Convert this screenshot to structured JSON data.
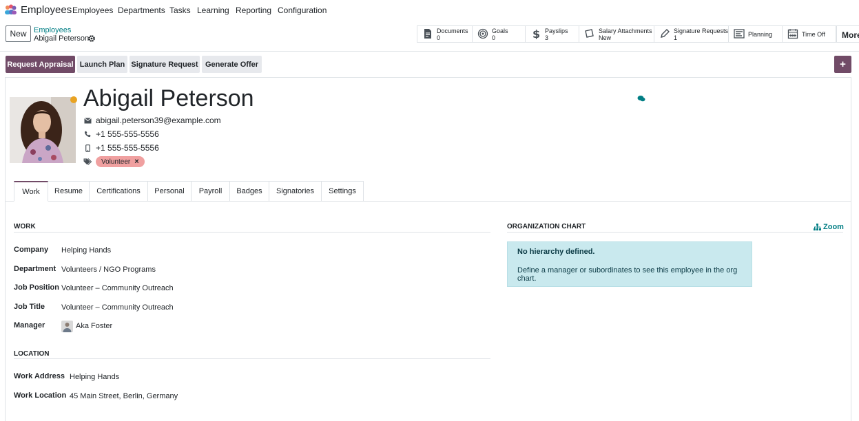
{
  "topnav": {
    "app_name": "Employees",
    "menu": [
      "Employees",
      "Departments",
      "Tasks",
      "Learning",
      "Reporting",
      "Configuration"
    ]
  },
  "control_panel": {
    "new_label": "New",
    "breadcrumb_parent": "Employees",
    "breadcrumb_current": "Abigail Peterson",
    "smart_buttons": [
      {
        "label": "Documents",
        "value": "0",
        "icon": "document-icon"
      },
      {
        "label": "Goals",
        "value": "0",
        "icon": "target-icon"
      },
      {
        "label": "Payslips",
        "value": "3",
        "icon": "dollar-icon"
      },
      {
        "label": "Salary Attachments",
        "value": "New",
        "icon": "money-icon"
      },
      {
        "label": "Signature Requests",
        "value": "1",
        "icon": "pen-icon"
      },
      {
        "label": "Planning",
        "value": "",
        "icon": "planning-icon"
      },
      {
        "label": "Time Off",
        "value": "",
        "icon": "calendar-icon"
      }
    ],
    "more_label": "More"
  },
  "actions": {
    "request_appraisal": "Request Appraisal",
    "launch_plan": "Launch Plan",
    "signature_request": "Signature Request",
    "generate_offer": "Generate Offer"
  },
  "employee": {
    "name": "Abigail Peterson",
    "email": "abigail.peterson39@example.com",
    "work_phone": "+1 555-555-5556",
    "mobile_phone": "+1 555-555-5556",
    "tag": "Volunteer",
    "status_color": "#e9a322"
  },
  "tabs": [
    "Work",
    "Resume",
    "Certifications",
    "Personal",
    "Payroll",
    "Badges",
    "Signatories",
    "Settings"
  ],
  "work_section": {
    "title": "WORK",
    "fields": [
      {
        "label": "Company",
        "value": "Helping Hands"
      },
      {
        "label": "Department",
        "value": "Volunteers / NGO Programs"
      },
      {
        "label": "Job Position",
        "value": "Volunteer – Community Outreach"
      },
      {
        "label": "Job Title",
        "value": "Volunteer – Community Outreach"
      },
      {
        "label": "Manager",
        "value": "Aka Foster"
      }
    ]
  },
  "location_section": {
    "title": "LOCATION",
    "fields": [
      {
        "label": "Work Address",
        "value": "Helping Hands"
      },
      {
        "label": "Work Location",
        "value": "45 Main Street, Berlin, Germany"
      }
    ]
  },
  "org_chart": {
    "title": "ORGANIZATION CHART",
    "zoom_label": "Zoom",
    "alert_title": "No hierarchy defined.",
    "alert_text": "Define a manager or subordinates to see this employee in the org chart."
  },
  "colors": {
    "brand": "#714b67",
    "link": "#017e84",
    "tag_bg": "#f0a0a0",
    "info_bg": "#c9e9ee"
  }
}
